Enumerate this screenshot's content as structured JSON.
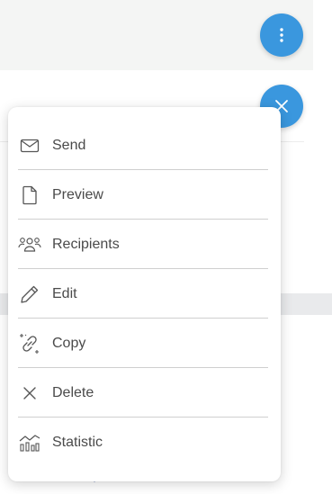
{
  "buttons": {
    "more": {
      "icon": "vertical-dots-icon"
    },
    "close": {
      "icon": "close-icon"
    }
  },
  "menu": {
    "items": [
      {
        "label": "Send",
        "icon": "envelope-icon"
      },
      {
        "label": "Preview",
        "icon": "document-icon"
      },
      {
        "label": "Recipients",
        "icon": "people-icon"
      },
      {
        "label": "Edit",
        "icon": "pencil-icon"
      },
      {
        "label": "Copy",
        "icon": "copy-link-icon"
      },
      {
        "label": "Delete",
        "icon": "x-icon"
      },
      {
        "label": "Statistic",
        "icon": "chart-icon"
      }
    ]
  },
  "colors": {
    "accent": "#3a97de",
    "text": "#4a4a4a",
    "divider": "#cfcfcf"
  }
}
